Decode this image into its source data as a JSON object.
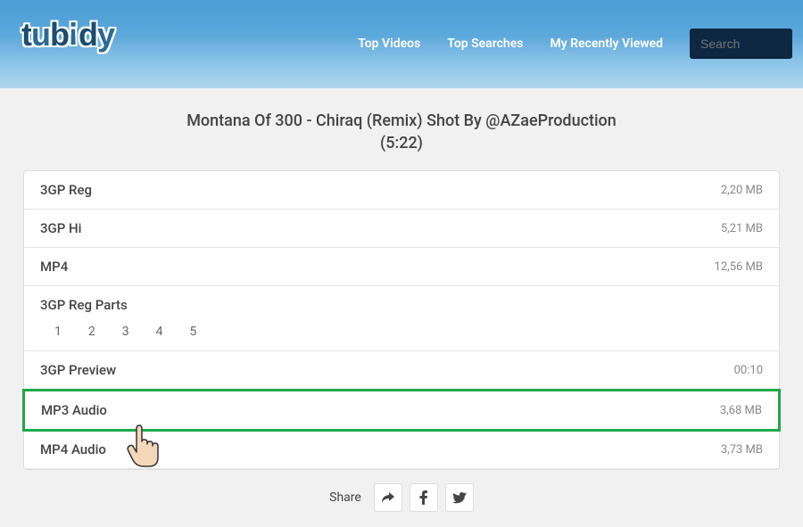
{
  "header": {
    "nav": {
      "top_videos": "Top Videos",
      "top_searches": "Top Searches",
      "my_recently_viewed": "My Recently Viewed"
    },
    "search_placeholder": "Search"
  },
  "video": {
    "title_line1": "Montana Of 300 - Chiraq (Remix) Shot By @AZaeProduction",
    "title_line2": "(5:22)"
  },
  "downloads": [
    {
      "format": "3GP Reg",
      "size": "2,20 MB"
    },
    {
      "format": "3GP Hi",
      "size": "5,21 MB"
    },
    {
      "format": "MP4",
      "size": "12,56 MB"
    }
  ],
  "parts": {
    "label": "3GP Reg Parts",
    "numbers": [
      "1",
      "2",
      "3",
      "4",
      "5"
    ]
  },
  "downloads2": [
    {
      "format": "3GP Preview",
      "size": "00:10"
    },
    {
      "format": "MP3 Audio",
      "size": "3,68 MB",
      "highlighted": true
    },
    {
      "format": "MP4 Audio",
      "size": "3,73 MB"
    }
  ],
  "share": {
    "label": "Share"
  }
}
